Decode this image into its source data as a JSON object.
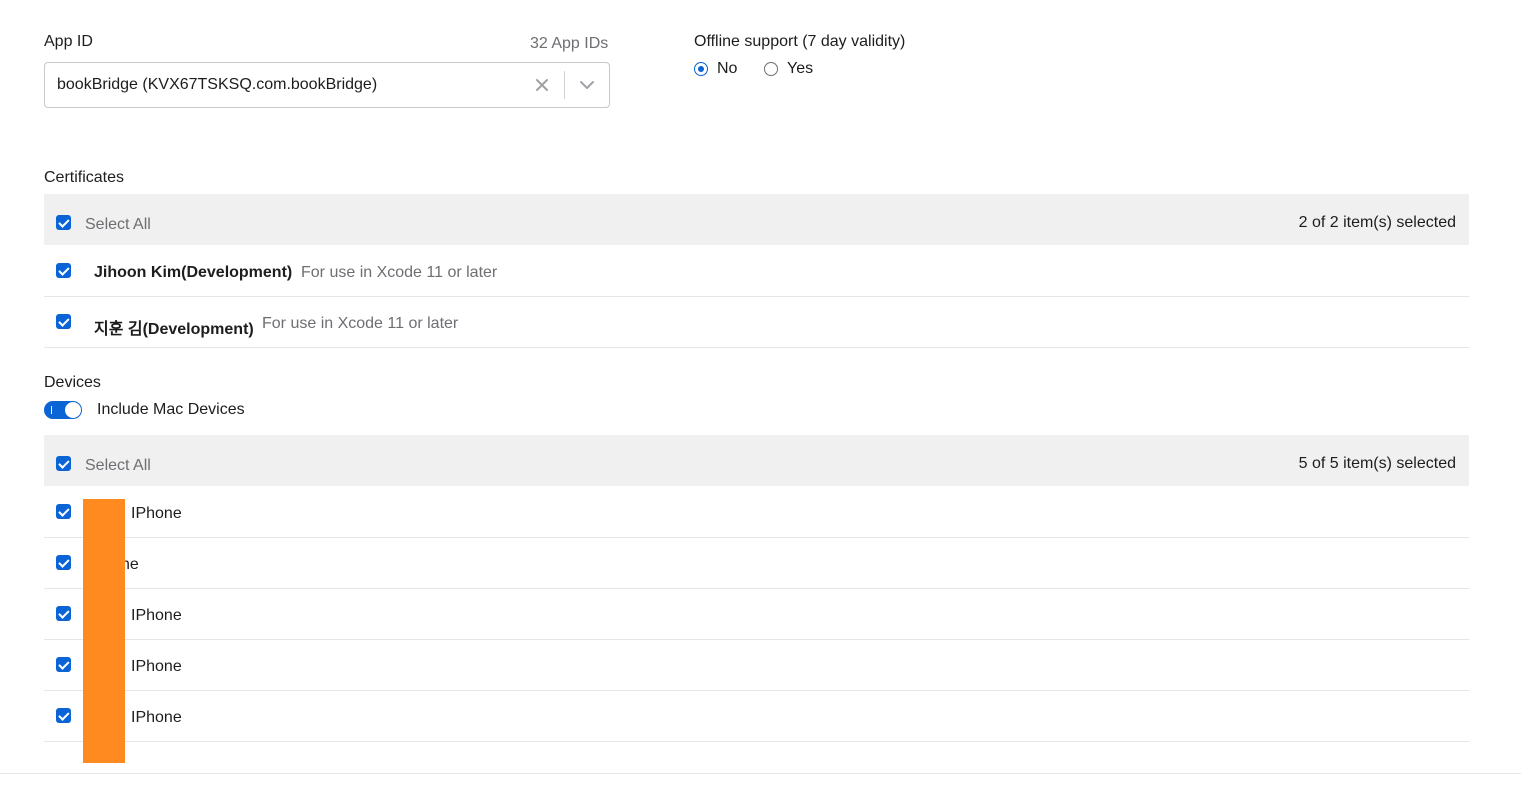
{
  "app_id": {
    "label": "App ID",
    "count": "32 App IDs",
    "value": "bookBridge (KVX67TSKSQ.com.bookBridge)"
  },
  "offline": {
    "label": "Offline support (7 day validity)",
    "options": [
      {
        "label": "No",
        "selected": true
      },
      {
        "label": "Yes",
        "selected": false
      }
    ]
  },
  "certificates": {
    "heading": "Certificates",
    "select_all": "Select All",
    "summary": "2 of 2 item(s) selected",
    "items": [
      {
        "name": "Jihoon Kim(Development)",
        "note": "For use in Xcode 11 or later",
        "checked": true
      },
      {
        "name": "지훈 김(Development)",
        "note": "For use in Xcode 11 or later",
        "checked": true
      }
    ]
  },
  "devices": {
    "heading": "Devices",
    "include_mac": "Include Mac Devices",
    "include_mac_on": true,
    "select_all": "Select All",
    "summary": "5 of 5 item(s) selected",
    "items": [
      {
        "name": "IPhone",
        "checked": true
      },
      {
        "name": "ne",
        "checked": true
      },
      {
        "name": "IPhone",
        "checked": true
      },
      {
        "name": "IPhone",
        "checked": true
      },
      {
        "name": "IPhone",
        "checked": true
      }
    ]
  },
  "colors": {
    "accent": "#0a64d6",
    "redaction": "#ff8a1f",
    "header_bg": "#f0f0f0"
  }
}
